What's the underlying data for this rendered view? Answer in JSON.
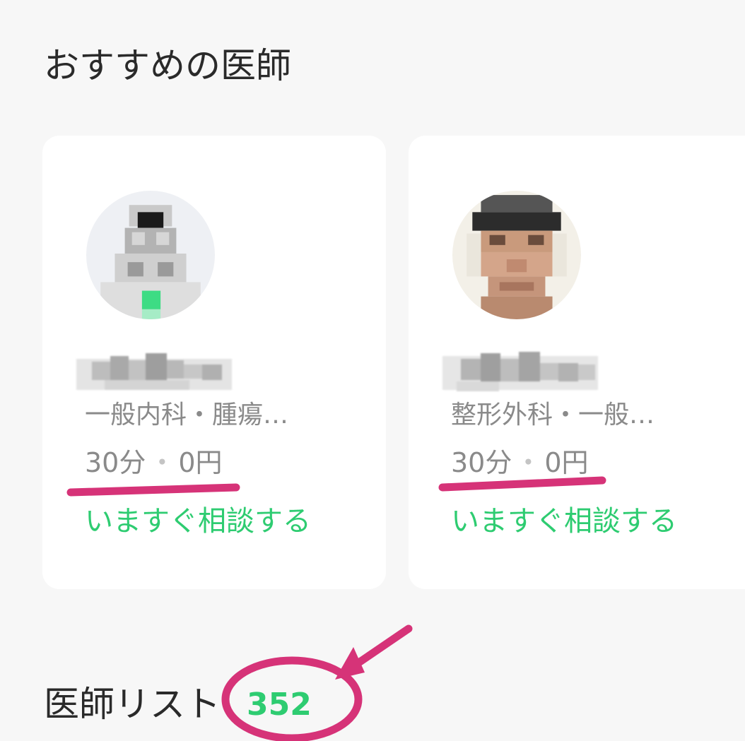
{
  "recommended": {
    "title": "おすすめの医師",
    "doctors": [
      {
        "specialty": "一般内科・腫瘍…",
        "duration": "30分",
        "separator": "・",
        "price": "0円",
        "cta": "いますぐ相談する"
      },
      {
        "specialty": "整形外科・一般…",
        "duration": "30分",
        "separator": "・",
        "price": "0円",
        "cta": "いますぐ相談する"
      }
    ]
  },
  "doctor_list": {
    "title": "医師リスト",
    "count": "352"
  },
  "colors": {
    "accent": "#2ecc71",
    "annotation": "#d63378",
    "muted_text": "#8a8a8a",
    "background": "#f7f7f7"
  },
  "icons": [
    "pixelated-avatar",
    "annotation-arrow"
  ]
}
